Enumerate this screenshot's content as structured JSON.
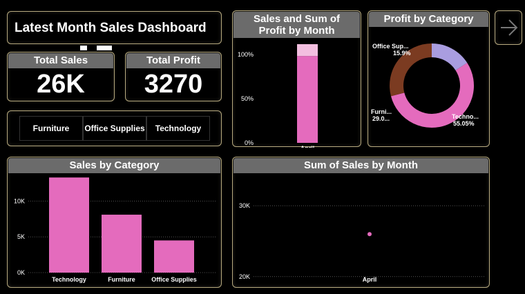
{
  "title": "Latest Month Sales Dashboard",
  "kpis": {
    "sales_label": "Total Sales",
    "sales_value": "26K",
    "profit_label": "Total Profit",
    "profit_value": "3270"
  },
  "slicer": {
    "items": [
      "Furniture",
      "Office Supplies",
      "Technology"
    ]
  },
  "nav": {
    "icon": "arrow-right-icon"
  },
  "colors": {
    "pink": "#e46bbd",
    "light_pink": "#f3bfe0",
    "brown": "#7b3b21",
    "lavender": "#a99de0",
    "header": "#6b6b6b",
    "border": "#b8ab80"
  },
  "chart_data": [
    {
      "id": "sales_profit_month",
      "type": "bar",
      "title": "Sales and Sum of Profit by Month",
      "categories": [
        "April"
      ],
      "series": [],
      "stack_percent": [
        88,
        12
      ],
      "yticks": [
        "0%",
        "50%",
        "100%"
      ],
      "ylim": [
        0,
        100
      ]
    },
    {
      "id": "profit_category",
      "type": "pie",
      "title": "Profit by Category",
      "labels": [
        "Technology",
        "Furniture",
        "Office Supplies"
      ],
      "values": [
        55.05,
        29.05,
        15.9
      ],
      "data_labels": [
        {
          "name": "Techno...",
          "pct": "55.05%"
        },
        {
          "name": "Furni...",
          "pct": "29.0..."
        },
        {
          "name": "Office Sup...",
          "pct": "15.9%"
        }
      ]
    },
    {
      "id": "sales_category",
      "type": "bar",
      "title": "Sales by Category",
      "categories": [
        "Technology",
        "Furniture",
        "Office Supplies"
      ],
      "values": [
        13300,
        8100,
        4500
      ],
      "yticks": [
        "0K",
        "5K",
        "10K"
      ],
      "ylim": [
        0,
        13800
      ]
    },
    {
      "id": "sales_month",
      "type": "scatter",
      "title": "Sum of Sales by Month",
      "categories": [
        "April"
      ],
      "values": [
        26000
      ],
      "yticks": [
        "20K",
        "30K"
      ],
      "ylim": [
        19100,
        34500
      ]
    }
  ]
}
